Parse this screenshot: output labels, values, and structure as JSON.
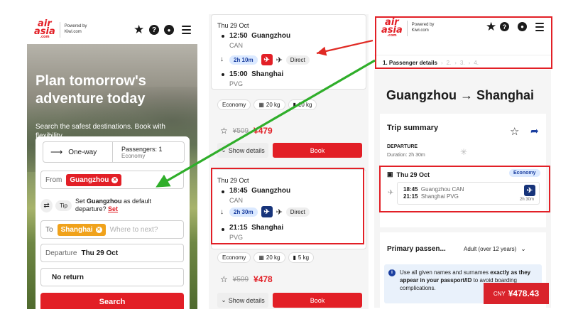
{
  "brand": {
    "logo_top": "air",
    "logo_bottom": "asia",
    "logo_sub": ".com",
    "powered_by": "Powered by",
    "partner": "Kiwi.com"
  },
  "colors": {
    "accent_red": "#e21f26",
    "arrow_red": "#e02a24",
    "arrow_green": "#2fae2a",
    "orange": "#f0a21b",
    "blue_pill": "#dbe9ff"
  },
  "header_icons": [
    "star-icon",
    "help-icon",
    "account-icon",
    "menu-icon"
  ],
  "search": {
    "hero_title": "Plan tomorrow's adventure today",
    "hero_subtitle": "Search the safest destinations. Book with flexibility.",
    "trip_type": "One-way",
    "passengers_label": "Passengers: 1",
    "cabin": "Economy",
    "from_label": "From",
    "from_value": "Guangzhou",
    "tip_label": "Tip",
    "tip_prefix": "Set ",
    "tip_city": "Guangzhou",
    "tip_suffix": " as default departure?",
    "tip_link": "Set",
    "to_label": "To",
    "to_value": "Shanghai",
    "to_placeholder": "Where to next?",
    "departure_label": "Departure",
    "departure_value": "Thu 29 Oct",
    "return_value": "No return",
    "search_button": "Search"
  },
  "results": [
    {
      "date": "Thu 29 Oct",
      "dep_time": "12:50",
      "dep_city": "Guangzhou",
      "dep_code": "CAN",
      "duration": "2h 10m",
      "stops": "Direct",
      "arr_time": "15:00",
      "arr_city": "Shanghai",
      "arr_code": "PVG",
      "cabin": "Economy",
      "bag_checked": "20 kg",
      "bag_cabin": "10 kg",
      "old_price": "¥509",
      "price": "¥479",
      "details_label": "Show details",
      "book_label": "Book"
    },
    {
      "date": "Thu 29 Oct",
      "dep_time": "18:45",
      "dep_city": "Guangzhou",
      "dep_code": "CAN",
      "duration": "2h 30m",
      "stops": "Direct",
      "arr_time": "21:15",
      "arr_city": "Shanghai",
      "arr_code": "PVG",
      "cabin": "Economy",
      "bag_checked": "20 kg",
      "bag_cabin": "5 kg",
      "old_price": "¥509",
      "price": "¥478",
      "details_label": "Show details",
      "book_label": "Book"
    }
  ],
  "booking": {
    "steps": [
      "1. Passenger details",
      "2.",
      "3.",
      "4."
    ],
    "route_title": "Guangzhou → Shanghai",
    "summary_title": "Trip summary",
    "departure_heading": "DEPARTURE",
    "duration": "Duration: 2h 30m",
    "date": "Thu 29 Oct",
    "cabin": "Economy",
    "dep_time": "18:45",
    "dep_place": "Guangzhou CAN",
    "arr_time": "21:15",
    "arr_place": "Shanghai PVG",
    "flight_duration": "2h 30m",
    "passenger_heading": "Primary passen...",
    "passenger_type": "Adult (over 12 years)",
    "notice_pre": "Use all given names and surnames ",
    "notice_bold1": "exactly as they appear in your passport/ID",
    "notice_post": " to avoid boarding complications.",
    "price_currency": "CNY",
    "price_value": "¥478.43"
  }
}
